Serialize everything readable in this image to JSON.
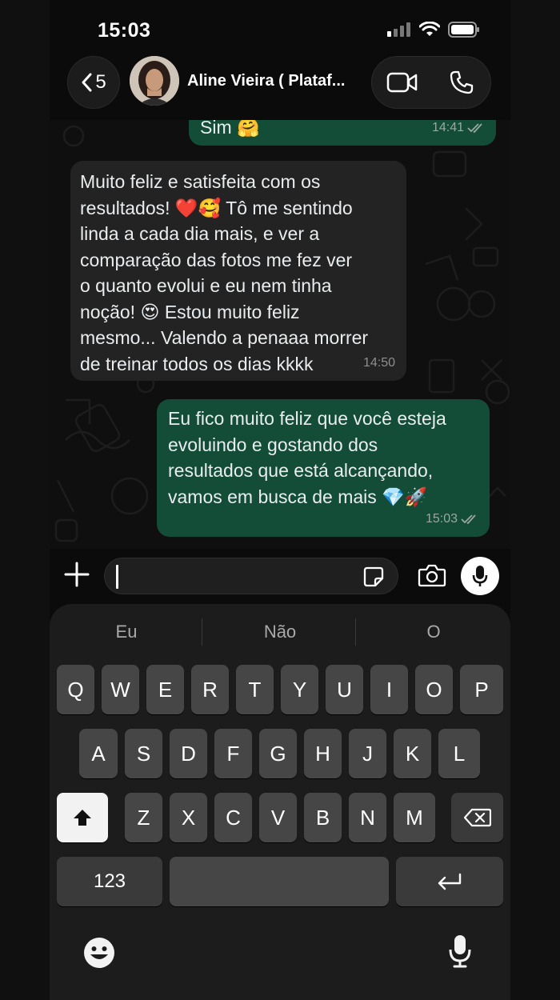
{
  "status_bar": {
    "time": "15:03"
  },
  "header": {
    "back_count": "5",
    "contact_name": "Aline Vieira ( Plataf..."
  },
  "messages": [
    {
      "direction": "out",
      "lines": [
        "Sim 🤗"
      ],
      "time": "14:41",
      "read": true
    },
    {
      "direction": "in",
      "lines": [
        "Muito feliz e satisfeita com os",
        "resultados! ❤️🥰 Tô me sentindo",
        "linda a cada dia mais, e ver a",
        "comparação das fotos me fez ver",
        "o quanto evolui e eu nem tinha",
        "noção! 😍 Estou muito feliz",
        "mesmo... Valendo a penaaa morrer",
        "de treinar todos os dias kkkk"
      ],
      "time": "14:50"
    },
    {
      "direction": "out",
      "lines": [
        "Eu fico muito feliz que você esteja",
        "evoluindo e gostando dos",
        "resultados que está alcançando,",
        "vamos em busca de mais 💎🚀"
      ],
      "time": "15:03",
      "read": true
    }
  ],
  "composer": {
    "value": ""
  },
  "keyboard": {
    "suggestions": [
      "Eu",
      "Não",
      "O"
    ],
    "row1": [
      "Q",
      "W",
      "E",
      "R",
      "T",
      "Y",
      "U",
      "I",
      "O",
      "P"
    ],
    "row2": [
      "A",
      "S",
      "D",
      "F",
      "G",
      "H",
      "J",
      "K",
      "L"
    ],
    "row3": [
      "Z",
      "X",
      "C",
      "V",
      "B",
      "N",
      "M"
    ],
    "numbers_label": "123"
  },
  "icons": {
    "back": "chevron-left-icon",
    "video": "video-camera-icon",
    "phone": "phone-icon",
    "plus": "plus-icon",
    "sticker": "sticker-icon",
    "camera": "camera-icon",
    "mic": "microphone-icon",
    "shift": "shift-icon",
    "delete": "backspace-icon",
    "return": "return-icon",
    "emoji": "emoji-icon",
    "dictation": "dictation-mic-icon"
  }
}
